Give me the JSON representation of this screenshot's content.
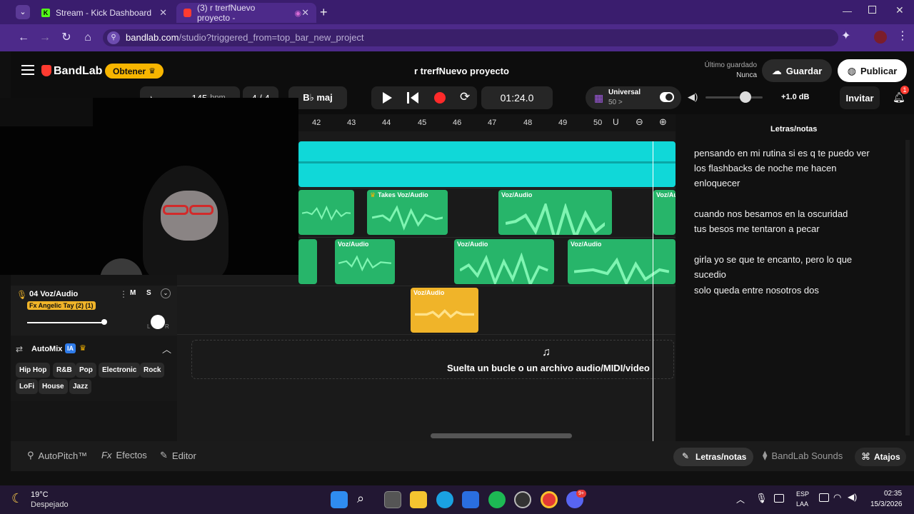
{
  "browser": {
    "tabs": [
      {
        "title": "Stream - Kick Dashboard"
      },
      {
        "title": "(3) r trerfNuevo proyecto -"
      }
    ],
    "url_host": "bandlab.com",
    "url_path": "/studio?triggered_from=top_bar_new_project"
  },
  "app": {
    "brand": "BandLab",
    "get_button": "Obtener",
    "project_title": "r  trerfNuevo proyecto",
    "last_saved_label": "Último guardado",
    "last_saved_value": "Nunca",
    "save_button": "Guardar",
    "publish_button": "Publicar"
  },
  "transport": {
    "tempo": "145",
    "tempo_unit": "bpm",
    "time_signature": "4 / 4",
    "key": "B♭ maj",
    "time": "01:24.0",
    "preset_name": "Universal",
    "preset_sub": "50 >",
    "master_volume": "+1.0 dB",
    "invite_button": "Invitar",
    "notification_count": "1"
  },
  "ruler": {
    "marks": [
      "42",
      "43",
      "44",
      "45",
      "46",
      "47",
      "48",
      "49",
      "50"
    ]
  },
  "clips": {
    "row2": [
      {
        "label": "Takes  Voz/Audio"
      },
      {
        "label": "Voz/Audio"
      },
      {
        "label": "Voz/Audio"
      }
    ],
    "row3": [
      {
        "label": "Voz/Audio"
      },
      {
        "label": "Voz/Audio"
      },
      {
        "label": "Voz/Audio"
      }
    ],
    "row4": [
      {
        "label": "Voz/Audio"
      }
    ]
  },
  "track4": {
    "name": "04  Voz/Audio",
    "mute": "M",
    "solo": "S",
    "fx": "Fx Angelic Tay (2) (1)",
    "pan_left": "L",
    "pan_right": "R"
  },
  "automix": {
    "title": "AutoMix",
    "ia_badge": "IA",
    "genres": [
      "Hip Hop",
      "R&B",
      "Pop",
      "Electronic",
      "Rock",
      "LoFi",
      "House",
      "Jazz"
    ]
  },
  "drop_zone": {
    "text": "Suelta un bucle o un archivo audio/MIDI/video"
  },
  "lyrics_panel": {
    "title": "Letras/notas",
    "lines": [
      "pensando en mi rutina  si  es q te puedo ver",
      "los flashbacks de noche me hacen",
      "enloquecer",
      "cuando nos besamos en la oscuridad",
      "tus besos me tentaron a pecar",
      "girla yo se que te encanto, pero lo que",
      "sucedio",
      "solo queda entre nosotros dos"
    ]
  },
  "bottom_bar": {
    "autopitch": "AutoPitch™",
    "effects": "Efectos",
    "editor": "Editor",
    "lyrics": "Letras/notas",
    "sounds": "BandLab Sounds",
    "shortcuts": "Atajos"
  },
  "taskbar": {
    "weather_temp": "19°C",
    "weather_desc": "Despejado",
    "lang": "ESP",
    "region": "LAA",
    "clock_time": "02:35",
    "clock_date": "15/3/2026",
    "discord_badge": "9+"
  },
  "colors": {
    "accent_purple": "#4d2a8a",
    "clip_cyan": "#10d8d8",
    "clip_green": "#2fcf7a",
    "clip_yellow": "#f0b429",
    "brand_red": "#ff3b30",
    "get_badge": "#f7b500"
  }
}
